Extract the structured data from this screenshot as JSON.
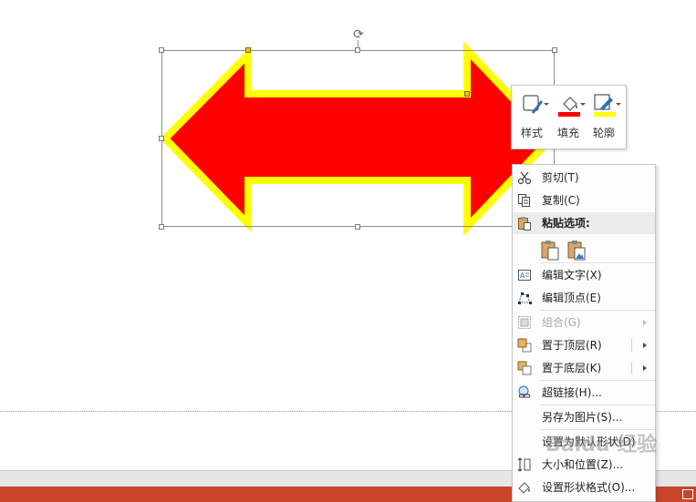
{
  "colors": {
    "arrow_fill": "#ff0000",
    "arrow_outline": "#ffff00",
    "status_bar": "#c8452a"
  },
  "mini_toolbar": {
    "style_label": "样式",
    "fill_label": "填充",
    "outline_label": "轮廓",
    "style_icon": "shape-style-icon",
    "fill_icon": "paint-bucket-icon",
    "outline_icon": "pen-outline-icon"
  },
  "context_menu": {
    "items": [
      {
        "label": "剪切(T)",
        "icon": "scissors-icon"
      },
      {
        "label": "复制(C)",
        "icon": "copy-icon"
      },
      {
        "label": "粘贴选项:",
        "icon": "paste-icon"
      },
      {
        "label": "编辑文字(X)",
        "icon": "edit-text-icon"
      },
      {
        "label": "编辑顶点(E)",
        "icon": "edit-points-icon"
      },
      {
        "label": "组合(G)",
        "icon": "group-icon",
        "disabled": true
      },
      {
        "label": "置于顶层(R)",
        "icon": "bring-to-front-icon"
      },
      {
        "label": "置于底层(K)",
        "icon": "send-to-back-icon"
      },
      {
        "label": "超链接(H)...",
        "icon": "hyperlink-icon"
      },
      {
        "label": "另存为图片(S)...",
        "icon": ""
      },
      {
        "label": "设置为默认形状(D)",
        "icon": ""
      },
      {
        "label": "大小和位置(Z)...",
        "icon": "size-position-icon"
      },
      {
        "label": "设置形状格式(O)...",
        "icon": "format-shape-icon"
      }
    ]
  },
  "watermark_text": "Baidu 经验"
}
